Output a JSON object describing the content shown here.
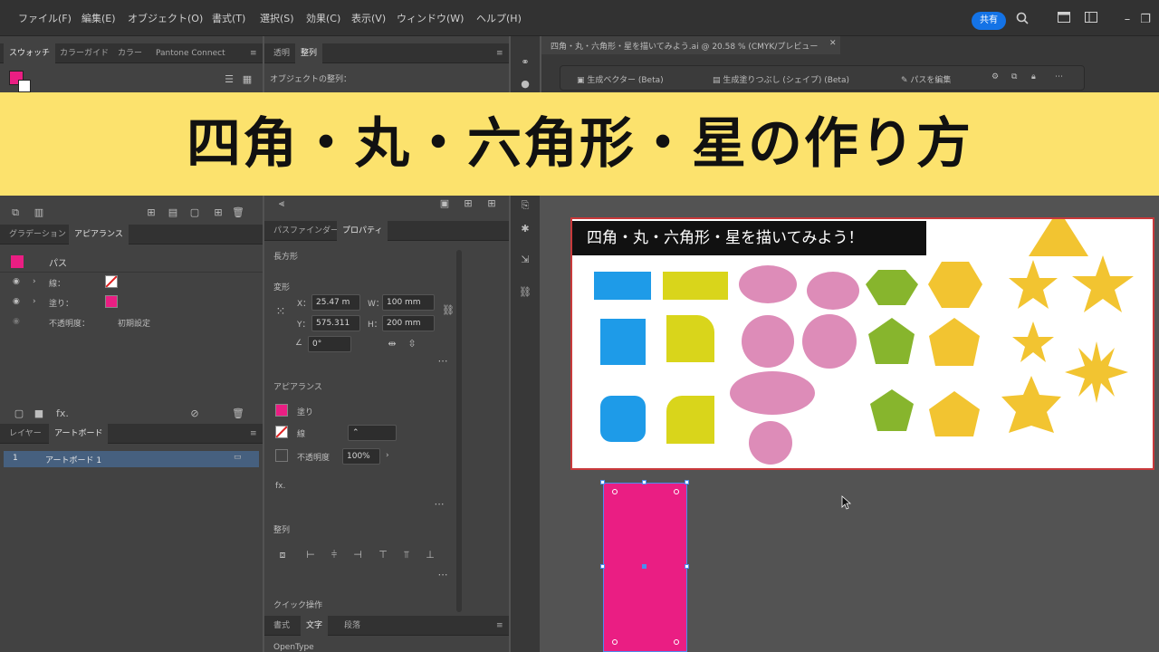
{
  "menu": {
    "items": [
      "ファイル(F)",
      "編集(E)",
      "オブジェクト(O)",
      "書式(T)",
      "選択(S)",
      "効果(C)",
      "表示(V)",
      "ウィンドウ(W)",
      "ヘルプ(H)"
    ],
    "share_label": "共有"
  },
  "swatches_panel": {
    "tabs": [
      "スウォッチ",
      "カラーガイド",
      "カラー",
      "Pantone Connect"
    ]
  },
  "align_panel": {
    "tabs": [
      "透明",
      "整列"
    ],
    "heading": "オブジェクトの整列："
  },
  "document_tab": {
    "title": "四角・丸・六角形・星を描いてみよう.ai @ 20.58 % (CMYK/プレビュー)"
  },
  "context_bar": {
    "items": [
      "生成ベクター (Beta)",
      "生成塗りつぶし (シェイプ) (Beta)",
      "パスを編集"
    ]
  },
  "banner": {
    "title": "四角・丸・六角形・星の作り方"
  },
  "appearance_panel": {
    "tabs": [
      "グラデーション",
      "アピアランス"
    ],
    "object_label": "パス",
    "rows": [
      {
        "label": "線："
      },
      {
        "label": "塗り："
      },
      {
        "label": "不透明度：",
        "value": "初期設定"
      }
    ]
  },
  "layers_panel": {
    "tabs": [
      "レイヤー",
      "アートボード"
    ],
    "row_index": "1",
    "row_label": "アートボード 1"
  },
  "properties_panel": {
    "tabs": [
      "パスファインダー",
      "プロパティ"
    ],
    "object_type": "長方形",
    "transform_heading": "変形",
    "x_label": "X：",
    "x_value": "25.47 m",
    "y_label": "Y：",
    "y_value": "575.311",
    "w_label": "W：",
    "w_value": "100 mm",
    "h_label": "H：",
    "h_value": "200 mm",
    "angle_value": "0°",
    "appearance_heading": "アピアランス",
    "fill_label": "塗り",
    "stroke_label": "線",
    "opacity_label": "不透明度",
    "opacity_value": "100%",
    "fx_label": "fx.",
    "align_heading": "整列",
    "quick_actions_heading": "クイック操作",
    "bottom_tabs": [
      "書式",
      "文字",
      "段落"
    ],
    "bottom_cut_text": "OpenType"
  },
  "artboard": {
    "title": "四角・丸・六角形・星を描いてみよう！"
  },
  "colors": {
    "blue": "#1e9be8",
    "yellow_green": "#d9d51b",
    "pink": "#dd8cb8",
    "green": "#87b52d",
    "gold": "#f2c431",
    "magenta": "#ea1e83",
    "banner": "#fce26d"
  },
  "icons": [
    "search-icon",
    "panel-layout-icon",
    "window-icon",
    "stack-icon",
    "close-icon",
    "menu-icon",
    "link-icon",
    "lock-icon",
    "more-icon",
    "eye-icon",
    "chevron-right-icon",
    "trash-icon",
    "add-icon"
  ]
}
